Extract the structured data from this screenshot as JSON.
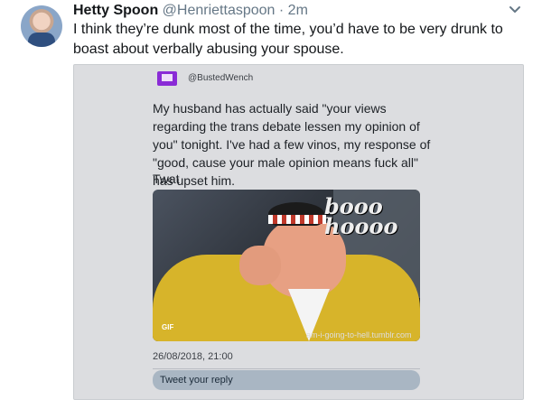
{
  "tweet": {
    "display_name": "Hetty Spoon",
    "handle": "@Henriettaspoon",
    "separator": "·",
    "time": "2m",
    "text": "I think they’re dunk most of the time, you’d have to be very drunk to boast about verbally abusing your spouse."
  },
  "screenshot": {
    "handle": "@BustedWench",
    "text": "My husband has actually said \"your views regarding the trans debate lessen my opinion of you\" tonight. I've had a few vinos, my response of \"good, cause your male opinion means fuck all\" has upset him.",
    "extra": "Twat",
    "gif": {
      "overlay_text": "booo hoooo",
      "badge": "GIF",
      "credit": "am-i-going-to-hell.tumblr.com"
    },
    "timestamp": "26/08/2018, 21:00",
    "reply_placeholder": "Tweet your reply"
  },
  "icons": {
    "chevron": "chevron-down-icon"
  }
}
